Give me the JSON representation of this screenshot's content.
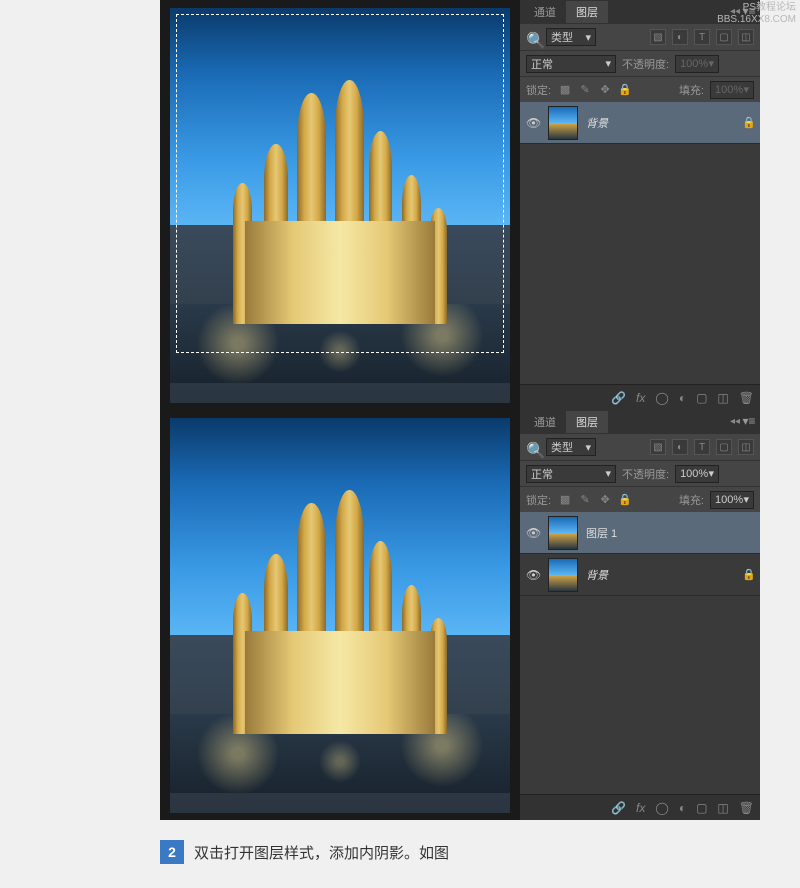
{
  "watermark": {
    "line1": "PS教程论坛",
    "line2": "BBS.16XX8.COM"
  },
  "panels": {
    "tabs": {
      "channels": "通道",
      "layers": "图层"
    },
    "filter_type": "类型",
    "blend_mode": "正常",
    "opacity_label": "不透明度:",
    "lock_label": "锁定:",
    "fill_label": "填充:",
    "opacity_val_disabled": "100%",
    "opacity_val": "100%",
    "fill_val_disabled": "100%",
    "fill_val": "100%"
  },
  "layers_top": {
    "bg": "背景"
  },
  "layers_bottom": {
    "layer1": "图层 1",
    "bg": "背景"
  },
  "step": {
    "num": "2",
    "text": "双击打开图层样式，添加内阴影。如图"
  }
}
